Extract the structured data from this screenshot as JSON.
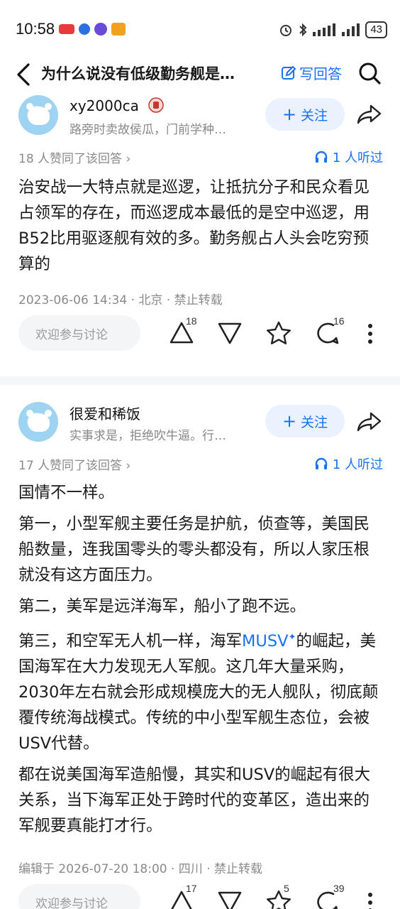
{
  "status_bar": {
    "time": "10:58",
    "battery": "43"
  },
  "header": {
    "question_title": "为什么说没有低级勤务舰是…",
    "write_answer": "写回答"
  },
  "answers": [
    {
      "author": "xy2000ca",
      "bio": "路旁时卖故侯瓜，门前学种…",
      "follow": "关注",
      "likes_text": "18 人赞同了该回答 ›",
      "listen_text": "1 人听过",
      "paragraphs": [
        "治安战一大特点就是巡逻，让抵抗分子和民众看见占领军的存在，而巡逻成本最低的是空中巡逻，用B52比用驱逐舰有效的多。勤务舰占人头会吃穷预算的"
      ],
      "meta": "2023-06-06 14:34 · 北京 · 禁止转载",
      "discuss_placeholder": "欢迎参与讨论",
      "upvotes": "18",
      "comments": "16"
    },
    {
      "author": "很爱和稀饭",
      "bio": "实事求是，拒绝吹牛逼。行…",
      "follow": "关注",
      "likes_text": "17 人赞同了该回答 ›",
      "listen_text": "1 人听过",
      "p1": "国情不一样。",
      "p2": "第一，小型军舰主要任务是护航，侦查等，美国民船数量，连我国零头的零头都没有，所以人家压根就没有这方面压力。",
      "p3": "第二，美军是远洋海军，船小了跑不远。",
      "p4_a": "第三，和空军无人机一样，海军",
      "p4_link": "MUSV",
      "p4_b": "的崛起，美国海军在大力发现无人军舰。这几年大量采购，2030年左右就会形成规模庞大的无人舰队，彻底颠覆传统海战模式。传统的中小型军舰生态位，会被USV代替。",
      "p5": "都在说美国海军造船慢，其实和USV的崛起有很大关系，当下海军正处于跨时代的变革区，造出来的军舰要真能打才行。",
      "meta": "编辑于 2026-07-20 18:00 · 四川 · 禁止转载",
      "discuss_placeholder": "欢迎参与讨论",
      "upvotes": "17",
      "favorites": "5",
      "comments": "39"
    }
  ],
  "colors": {
    "accent": "#1772f6",
    "muted": "#8a8a8a"
  }
}
